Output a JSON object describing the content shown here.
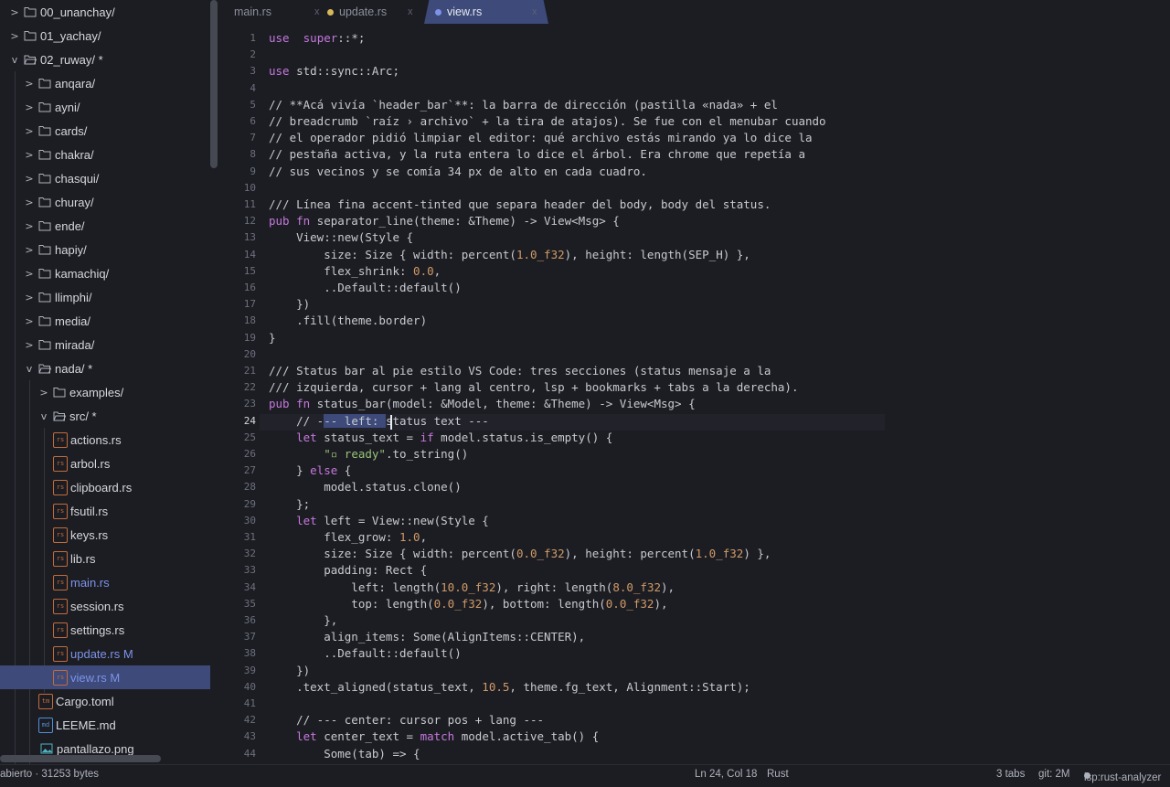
{
  "tabs": [
    {
      "label": "main.rs",
      "close": "x",
      "active": false,
      "modified": false
    },
    {
      "label": "update.rs",
      "close": "x",
      "active": false,
      "modified": true,
      "dot_color": "#d9b85a"
    },
    {
      "label": "view.rs",
      "close": "x",
      "active": true,
      "modified": true,
      "dot_color": "#7d93e8"
    }
  ],
  "tree": [
    {
      "arrow": ">",
      "kind": "folder",
      "label": "00_unanchay/",
      "depth": 0
    },
    {
      "arrow": ">",
      "kind": "folder",
      "label": "01_yachay/",
      "depth": 0
    },
    {
      "arrow": "v",
      "kind": "folder-open",
      "label": "02_ruway/ *",
      "depth": 0
    },
    {
      "arrow": ">",
      "kind": "folder",
      "label": "anqara/",
      "depth": 1
    },
    {
      "arrow": ">",
      "kind": "folder",
      "label": "ayni/",
      "depth": 1
    },
    {
      "arrow": ">",
      "kind": "folder",
      "label": "cards/",
      "depth": 1
    },
    {
      "arrow": ">",
      "kind": "folder",
      "label": "chakra/",
      "depth": 1
    },
    {
      "arrow": ">",
      "kind": "folder",
      "label": "chasqui/",
      "depth": 1
    },
    {
      "arrow": ">",
      "kind": "folder",
      "label": "churay/",
      "depth": 1
    },
    {
      "arrow": ">",
      "kind": "folder",
      "label": "ende/",
      "depth": 1
    },
    {
      "arrow": ">",
      "kind": "folder",
      "label": "hapiy/",
      "depth": 1
    },
    {
      "arrow": ">",
      "kind": "folder",
      "label": "kamachiq/",
      "depth": 1
    },
    {
      "arrow": ">",
      "kind": "folder",
      "label": "llimphi/",
      "depth": 1
    },
    {
      "arrow": ">",
      "kind": "folder",
      "label": "media/",
      "depth": 1
    },
    {
      "arrow": ">",
      "kind": "folder",
      "label": "mirada/",
      "depth": 1
    },
    {
      "arrow": "v",
      "kind": "folder-open",
      "label": "nada/ *",
      "depth": 1
    },
    {
      "arrow": ">",
      "kind": "folder",
      "label": "examples/",
      "depth": 2
    },
    {
      "arrow": "v",
      "kind": "folder-open",
      "label": "src/ *",
      "depth": 2
    },
    {
      "arrow": "",
      "kind": "rs",
      "badge": "rs",
      "label": "actions.rs",
      "depth": 3
    },
    {
      "arrow": "",
      "kind": "rs",
      "badge": "rs",
      "label": "arbol.rs",
      "depth": 3
    },
    {
      "arrow": "",
      "kind": "rs",
      "badge": "rs",
      "label": "clipboard.rs",
      "depth": 3
    },
    {
      "arrow": "",
      "kind": "rs",
      "badge": "rs",
      "label": "fsutil.rs",
      "depth": 3
    },
    {
      "arrow": "",
      "kind": "rs",
      "badge": "rs",
      "label": "keys.rs",
      "depth": 3
    },
    {
      "arrow": "",
      "kind": "rs",
      "badge": "rs",
      "label": "lib.rs",
      "depth": 3
    },
    {
      "arrow": "",
      "kind": "rs",
      "badge": "rs",
      "label": "main.rs",
      "depth": 3,
      "modified": true
    },
    {
      "arrow": "",
      "kind": "rs",
      "badge": "rs",
      "label": "session.rs",
      "depth": 3
    },
    {
      "arrow": "",
      "kind": "rs",
      "badge": "rs",
      "label": "settings.rs",
      "depth": 3
    },
    {
      "arrow": "",
      "kind": "rs",
      "badge": "rs",
      "label": "update.rs M",
      "depth": 3,
      "modified": true
    },
    {
      "arrow": "",
      "kind": "rs",
      "badge": "rs",
      "label": "view.rs M",
      "depth": 3,
      "modified": true,
      "selected": true
    },
    {
      "arrow": "",
      "kind": "tm",
      "badge": "tm",
      "label": "Cargo.toml",
      "depth": 2
    },
    {
      "arrow": "",
      "kind": "md",
      "badge": "md",
      "label": "LEEME.md",
      "depth": 2
    },
    {
      "arrow": "",
      "kind": "img",
      "label": "pantallazo.png",
      "depth": 2
    }
  ],
  "editor": {
    "current_line": 24,
    "lines": [
      [
        [
          "kw",
          "use"
        ],
        [
          "",
          "  "
        ],
        [
          "kw",
          "super"
        ],
        [
          "",
          "::*;"
        ]
      ],
      [],
      [
        [
          "kw",
          "use"
        ],
        [
          "",
          " std::sync::Arc;"
        ]
      ],
      [],
      [
        [
          "cm",
          "// **Acá vivía `header_bar`**: la barra de dirección (pastilla «nada» + el"
        ]
      ],
      [
        [
          "cm",
          "// breadcrumb `raíz › archivo` + la tira de atajos). Se fue con el menubar cuando"
        ]
      ],
      [
        [
          "cm",
          "// el operador pidió limpiar el editor: qué archivo estás mirando ya lo dice la"
        ]
      ],
      [
        [
          "cm",
          "// pestaña activa, y la ruta entera lo dice el árbol. Era chrome que repetía a"
        ]
      ],
      [
        [
          "cm",
          "// sus vecinos y se comía 34 px de alto en cada cuadro."
        ]
      ],
      [],
      [
        [
          "cm",
          "/// Línea fina accent-tinted que separa header del body, body del status."
        ]
      ],
      [
        [
          "kw",
          "pub fn"
        ],
        [
          "",
          " separator_line(theme: &Theme) -> View<Msg> {"
        ]
      ],
      [
        [
          "",
          "    View::new(Style {"
        ]
      ],
      [
        [
          "",
          "        size: Size { width: percent("
        ],
        [
          "num",
          "1.0_f32"
        ],
        [
          "",
          "), height: length(SEP_H) },"
        ]
      ],
      [
        [
          "",
          "        flex_shrink: "
        ],
        [
          "num",
          "0.0"
        ],
        [
          "",
          ","
        ]
      ],
      [
        [
          "",
          "        ..Default::default()"
        ]
      ],
      [
        [
          "",
          "    })"
        ]
      ],
      [
        [
          "",
          "    .fill(theme.border)"
        ]
      ],
      [
        [
          "",
          "}"
        ]
      ],
      [],
      [
        [
          "cm",
          "/// Status bar al pie estilo VS Code: tres secciones (status mensaje a la"
        ]
      ],
      [
        [
          "cm",
          "/// izquierda, cursor + lang al centro, lsp + bookmarks + tabs a la derecha)."
        ]
      ],
      [
        [
          "kw",
          "pub fn"
        ],
        [
          "",
          " status_bar(model: &Model, theme: &Theme) -> View<Msg> {"
        ]
      ],
      [
        [
          "cm",
          "    // -"
        ],
        [
          "sel",
          "-- left: "
        ],
        [
          "cm",
          "status text ---"
        ]
      ],
      [
        [
          "",
          "    "
        ],
        [
          "kw",
          "let"
        ],
        [
          "",
          " status_text = "
        ],
        [
          "kw",
          "if"
        ],
        [
          "",
          " model.status.is_empty() {"
        ]
      ],
      [
        [
          "",
          "        "
        ],
        [
          "str",
          "\"▫ ready\""
        ],
        [
          "",
          ".to_string()"
        ]
      ],
      [
        [
          "",
          "    } "
        ],
        [
          "kw",
          "else"
        ],
        [
          "",
          " {"
        ]
      ],
      [
        [
          "",
          "        model.status.clone()"
        ]
      ],
      [
        [
          "",
          "    };"
        ]
      ],
      [
        [
          "",
          "    "
        ],
        [
          "kw",
          "let"
        ],
        [
          "",
          " left = View::new(Style {"
        ]
      ],
      [
        [
          "",
          "        flex_grow: "
        ],
        [
          "num",
          "1.0"
        ],
        [
          "",
          ","
        ]
      ],
      [
        [
          "",
          "        size: Size { width: percent("
        ],
        [
          "num",
          "0.0_f32"
        ],
        [
          "",
          "), height: percent("
        ],
        [
          "num",
          "1.0_f32"
        ],
        [
          "",
          ") },"
        ]
      ],
      [
        [
          "",
          "        padding: Rect {"
        ]
      ],
      [
        [
          "",
          "            left: length("
        ],
        [
          "num",
          "10.0_f32"
        ],
        [
          "",
          "), right: length("
        ],
        [
          "num",
          "8.0_f32"
        ],
        [
          "",
          "),"
        ]
      ],
      [
        [
          "",
          "            top: length("
        ],
        [
          "num",
          "0.0_f32"
        ],
        [
          "",
          "), bottom: length("
        ],
        [
          "num",
          "0.0_f32"
        ],
        [
          "",
          "),"
        ]
      ],
      [
        [
          "",
          "        },"
        ]
      ],
      [
        [
          "",
          "        align_items: Some(AlignItems::CENTER),"
        ]
      ],
      [
        [
          "",
          "        ..Default::default()"
        ]
      ],
      [
        [
          "",
          "    })"
        ]
      ],
      [
        [
          "",
          "    .text_aligned(status_text, "
        ],
        [
          "num",
          "10.5"
        ],
        [
          "",
          ", theme.fg_text, Alignment::Start);"
        ]
      ],
      [],
      [
        [
          "cm",
          "    // --- center: cursor pos + lang ---"
        ]
      ],
      [
        [
          "",
          "    "
        ],
        [
          "kw",
          "let"
        ],
        [
          "",
          " center_text = "
        ],
        [
          "kw",
          "match"
        ],
        [
          "",
          " model.active_tab() {"
        ]
      ],
      [
        [
          "",
          "        Some(tab) => {"
        ]
      ]
    ]
  },
  "status": {
    "left": "abierto · 31253 bytes",
    "cursor": "Ln 24, Col 18",
    "lang": "Rust",
    "tabs": "3 tabs",
    "git": "git: 2M",
    "lsp": "lsp:rust-analyzer"
  },
  "colors": {
    "accent": "#3d4a7a",
    "modified": "#7d93e8",
    "keyword": "#c678dd",
    "number": "#d19a66",
    "string": "#98c379"
  }
}
